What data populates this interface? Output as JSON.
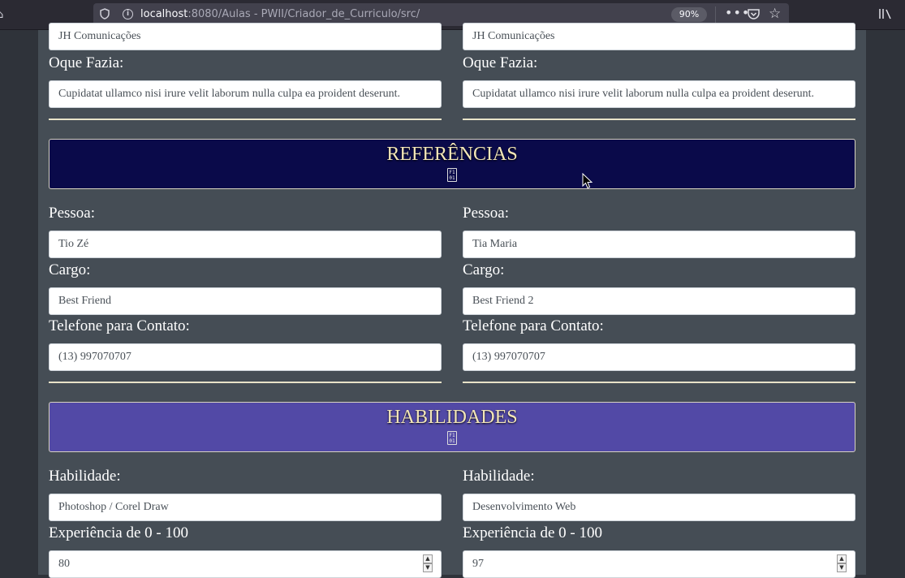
{
  "browser": {
    "url_host": "localhost",
    "url_rest": ":8080/Aulas - PWII/Criador_de_Curriculo/src/",
    "zoom": "90%"
  },
  "experience": {
    "left": {
      "company_value": "JH Comunicações",
      "duties_label": "Oque Fazia:",
      "duties_value": "Cupidatat ullamco nisi irure velit laborum nulla culpa ea proident deserunt."
    },
    "right": {
      "company_value": "JH Comunicações",
      "duties_label": "Oque Fazia:",
      "duties_value": "Cupidatat ullamco nisi irure velit laborum nulla culpa ea proident deserunt."
    }
  },
  "references": {
    "title": "REFERÊNCIAS",
    "icon_text": "F1 01",
    "color": "#0a0a4a",
    "left": {
      "person_label": "Pessoa:",
      "person_value": "Tio Zé",
      "role_label": "Cargo:",
      "role_value": "Best Friend",
      "phone_label": "Telefone para Contato:",
      "phone_value": "(13) 997070707"
    },
    "right": {
      "person_label": "Pessoa:",
      "person_value": "Tia Maria",
      "role_label": "Cargo:",
      "role_value": "Best Friend 2",
      "phone_label": "Telefone para Contato:",
      "phone_value": "(13) 997070707"
    }
  },
  "skills": {
    "title": "HABILIDADES",
    "icon_text": "F1 01",
    "color": "#5249a6",
    "left": {
      "skill_label": "Habilidade:",
      "skill_value": "Photoshop / Corel Draw",
      "experience_label": "Experiência de 0 - 100",
      "experience_value": "80"
    },
    "right": {
      "skill_label": "Habilidade:",
      "skill_value": " Desenvolvimento Web",
      "experience_label": "Experiência de 0 - 100",
      "experience_value": "97"
    }
  }
}
